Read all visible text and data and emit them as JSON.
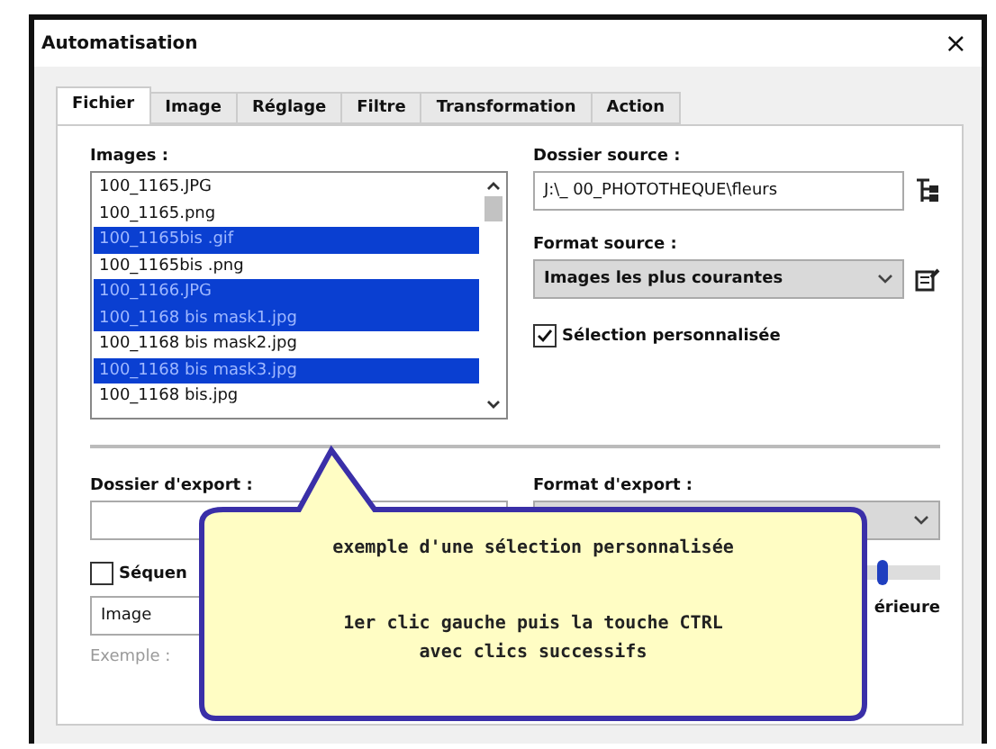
{
  "window": {
    "title": "Automatisation",
    "close": "×"
  },
  "tabs": [
    {
      "label": "Fichier",
      "selected": true
    },
    {
      "label": "Image",
      "selected": false
    },
    {
      "label": "Réglage",
      "selected": false
    },
    {
      "label": "Filtre",
      "selected": false
    },
    {
      "label": "Transformation",
      "selected": false
    },
    {
      "label": "Action",
      "selected": false
    }
  ],
  "images": {
    "label": "Images :",
    "items": [
      {
        "name": "100_1165.JPG",
        "selected": false
      },
      {
        "name": "100_1165.png",
        "selected": false
      },
      {
        "name": "100_1165bis .gif",
        "selected": true
      },
      {
        "name": "100_1165bis .png",
        "selected": false
      },
      {
        "name": "100_1166.JPG",
        "selected": true
      },
      {
        "name": "100_1168 bis mask1.jpg",
        "selected": true
      },
      {
        "name": "100_1168 bis mask2.jpg",
        "selected": false
      },
      {
        "name": "100_1168 bis mask3.jpg",
        "selected": true
      },
      {
        "name": "100_1168 bis.jpg",
        "selected": false
      }
    ]
  },
  "source_folder": {
    "label": "Dossier source :",
    "value": "J:\\_ 00_PHOTOTHEQUE\\fleurs"
  },
  "source_format": {
    "label": "Format source :",
    "value": "Images les plus courantes"
  },
  "custom_selection": {
    "label": "Sélection personnalisée",
    "checked": true
  },
  "export_folder": {
    "label": "Dossier d'export :"
  },
  "export_format": {
    "label": "Format d'export :"
  },
  "sequence": {
    "label": "Séquen",
    "checked": false
  },
  "name_field": {
    "value": "Image"
  },
  "example": {
    "label": "Exemple :"
  },
  "quality": {
    "level": 0.86,
    "caption": "érieure"
  },
  "callout": {
    "lines": [
      "exemple d'une sélection personnalisée",
      "1er clic gauche puis la touche CTRL",
      "avec clics successifs"
    ]
  }
}
